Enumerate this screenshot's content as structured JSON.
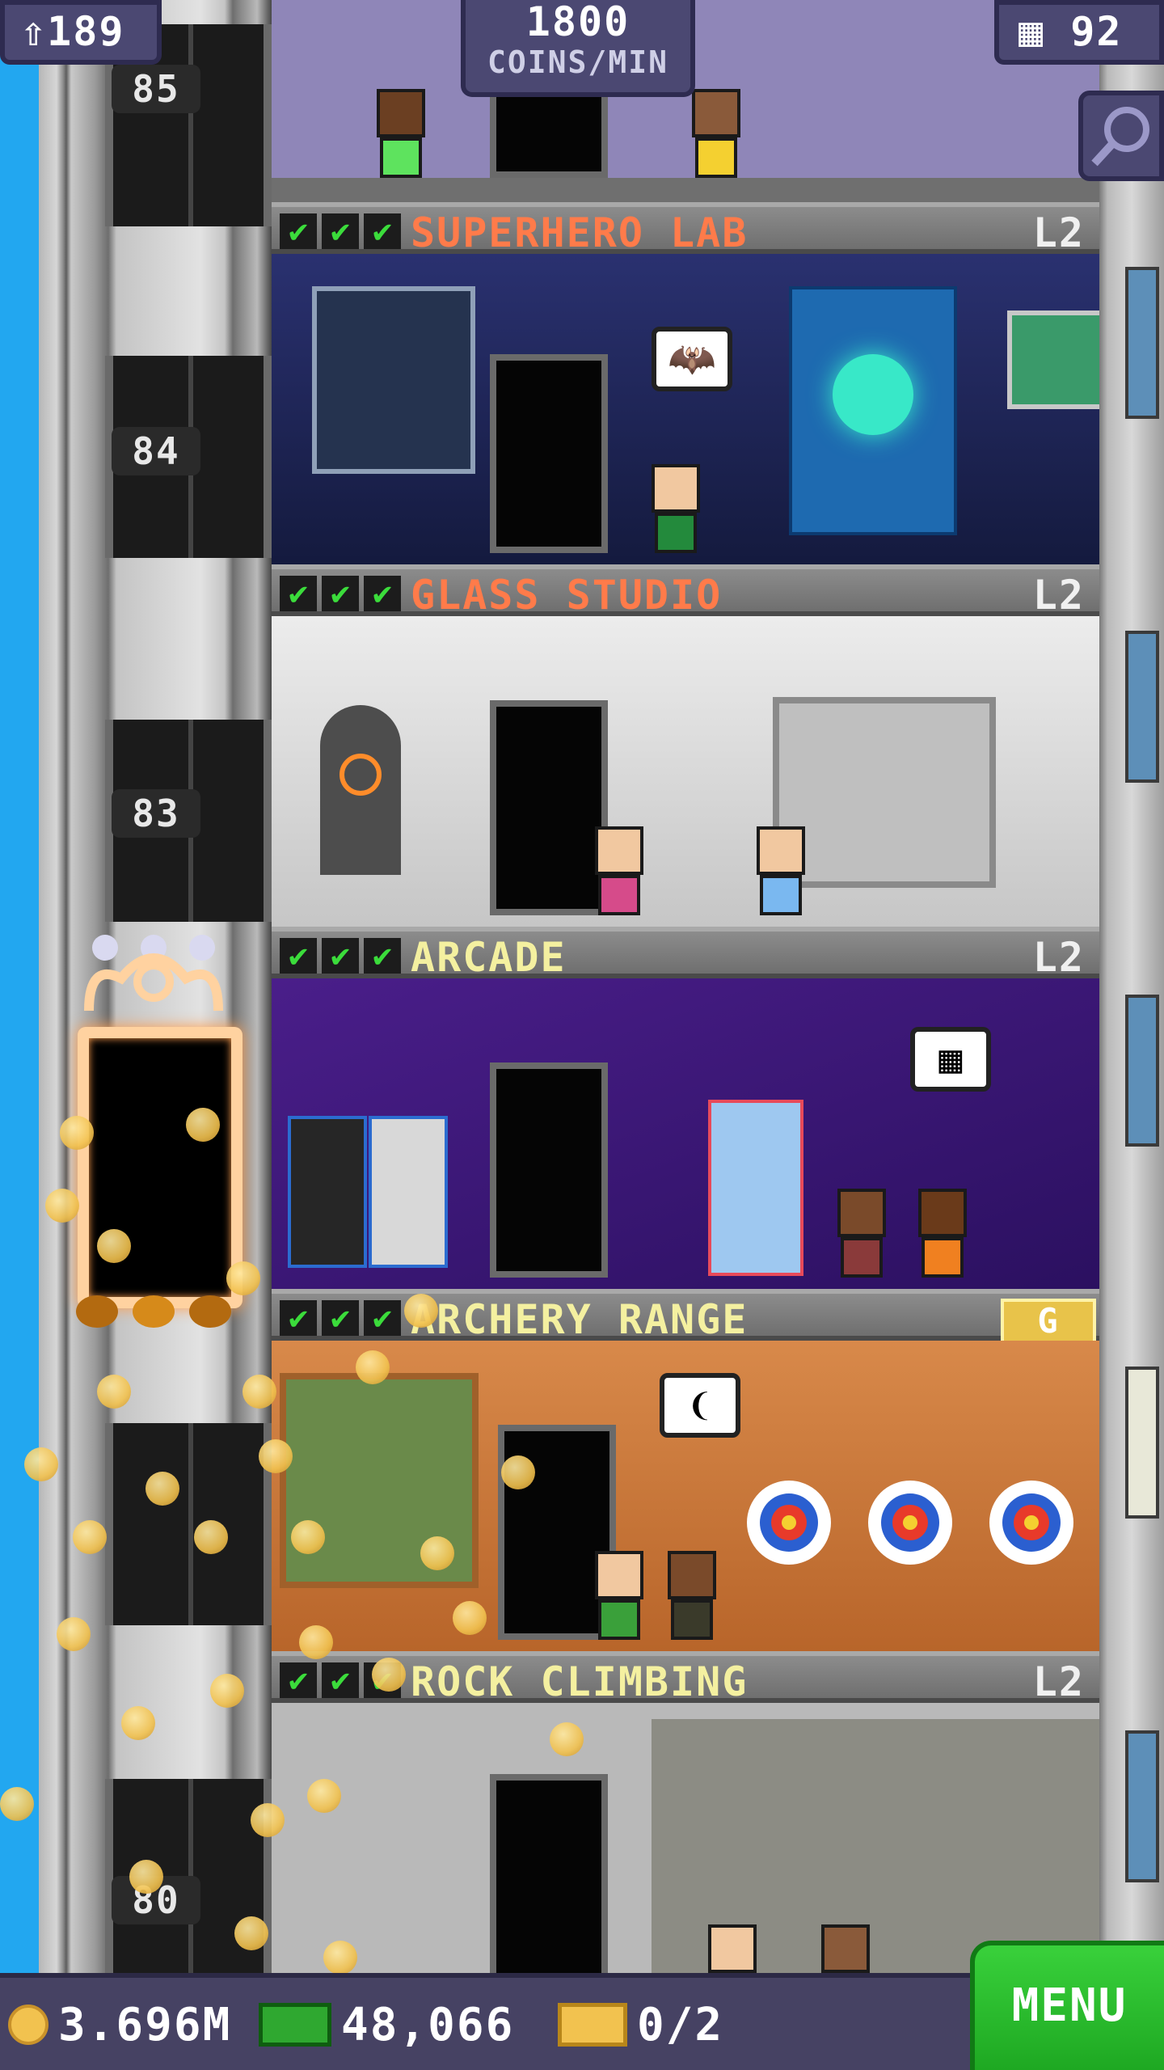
{
  "hud_top": {
    "population": "189",
    "coins_per_min_value": "1800",
    "coins_per_min_unit": "COINS/MIN",
    "floors_count": "92",
    "population_icon": "person-up-icon",
    "floors_icon": "building-icon",
    "search_icon": "magnifier-icon"
  },
  "elevator": {
    "floor_numbers": [
      "85",
      "84",
      "83",
      "80"
    ]
  },
  "floors": [
    {
      "name": "SUPERHERO LAB",
      "level": "L2",
      "name_color": "#ff7b4a",
      "stars": 3
    },
    {
      "name": "GLASS STUDIO",
      "level": "L2",
      "name_color": "#ff7b4a",
      "stars": 3
    },
    {
      "name": "ARCADE",
      "level": "L2",
      "name_color": "#f4f0a0",
      "stars": 3
    },
    {
      "name": "ARCHERY RANGE",
      "level": "G",
      "name_color": "#f4f0a0",
      "stars": 3
    },
    {
      "name": "ROCK CLIMBING",
      "level": "L2",
      "name_color": "#f4f0a0",
      "stars": 3
    }
  ],
  "hud_bottom": {
    "coins": "3.696M",
    "bux": "48,066",
    "tickets": "0/2",
    "menu_label": "MENU",
    "coin_icon": "coin-icon",
    "bux_icon": "banknote-icon",
    "ticket_icon": "ticket-icon"
  },
  "colors": {
    "hud_bg": "#4b4872",
    "menu_green": "#2cc22f",
    "check_green": "#3bdc3b",
    "sky": "#22a7f0"
  }
}
